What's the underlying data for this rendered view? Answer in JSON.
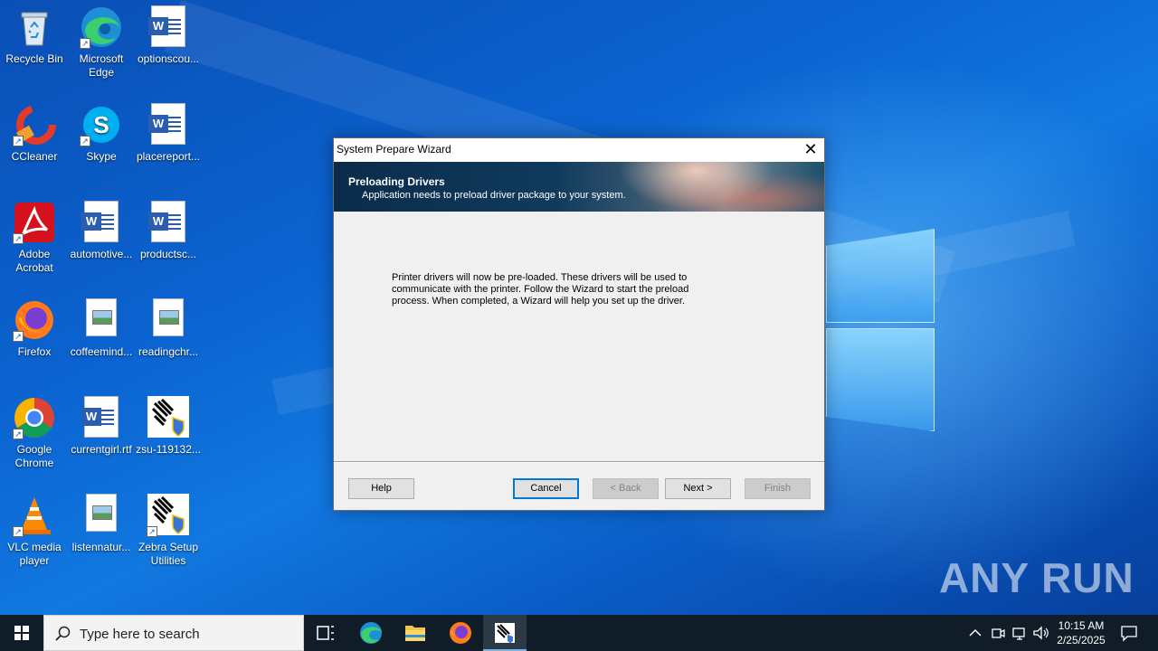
{
  "desktop": {
    "icons": [
      {
        "label": "Recycle Bin",
        "icon": "recycle-bin-icon"
      },
      {
        "label": "Microsoft Edge",
        "icon": "edge-icon"
      },
      {
        "label": "optionscou...",
        "icon": "word-document-icon"
      },
      {
        "label": "CCleaner",
        "icon": "ccleaner-icon"
      },
      {
        "label": "Skype",
        "icon": "skype-icon"
      },
      {
        "label": "placereport...",
        "icon": "word-document-icon"
      },
      {
        "label": "Adobe Acrobat",
        "icon": "acrobat-icon"
      },
      {
        "label": "automotive...",
        "icon": "word-document-icon"
      },
      {
        "label": "productsc...",
        "icon": "word-document-icon"
      },
      {
        "label": "Firefox",
        "icon": "firefox-icon"
      },
      {
        "label": "coffeemind...",
        "icon": "image-file-icon"
      },
      {
        "label": "readingchr...",
        "icon": "image-file-icon"
      },
      {
        "label": "Google Chrome",
        "icon": "chrome-icon"
      },
      {
        "label": "currentgirl.rtf",
        "icon": "word-document-icon"
      },
      {
        "label": "zsu-119132...",
        "icon": "zebra-installer-icon"
      },
      {
        "label": "VLC media player",
        "icon": "vlc-icon"
      },
      {
        "label": "listennatur...",
        "icon": "image-file-icon"
      },
      {
        "label": "Zebra Setup Utilities",
        "icon": "zebra-installer-icon"
      }
    ],
    "watermark": "ANY RUN"
  },
  "dialog": {
    "title": "System Prepare Wizard",
    "close_glyph": "✕",
    "header_title": "Preloading Drivers",
    "header_subtitle": "Application needs to preload driver package to your system.",
    "body_lines": [
      "Printer drivers will now be pre-loaded. These drivers will be used to",
      "communicate with the printer. Follow the Wizard to start the preload",
      "process. When completed, a Wizard will help you set up the driver."
    ],
    "buttons": {
      "help": "Help",
      "cancel": "Cancel",
      "back": "< Back",
      "next": "Next >",
      "finish": "Finish"
    }
  },
  "taskbar": {
    "search_placeholder": "Type here to search",
    "time": "10:15 AM",
    "date": "2/25/2025"
  }
}
